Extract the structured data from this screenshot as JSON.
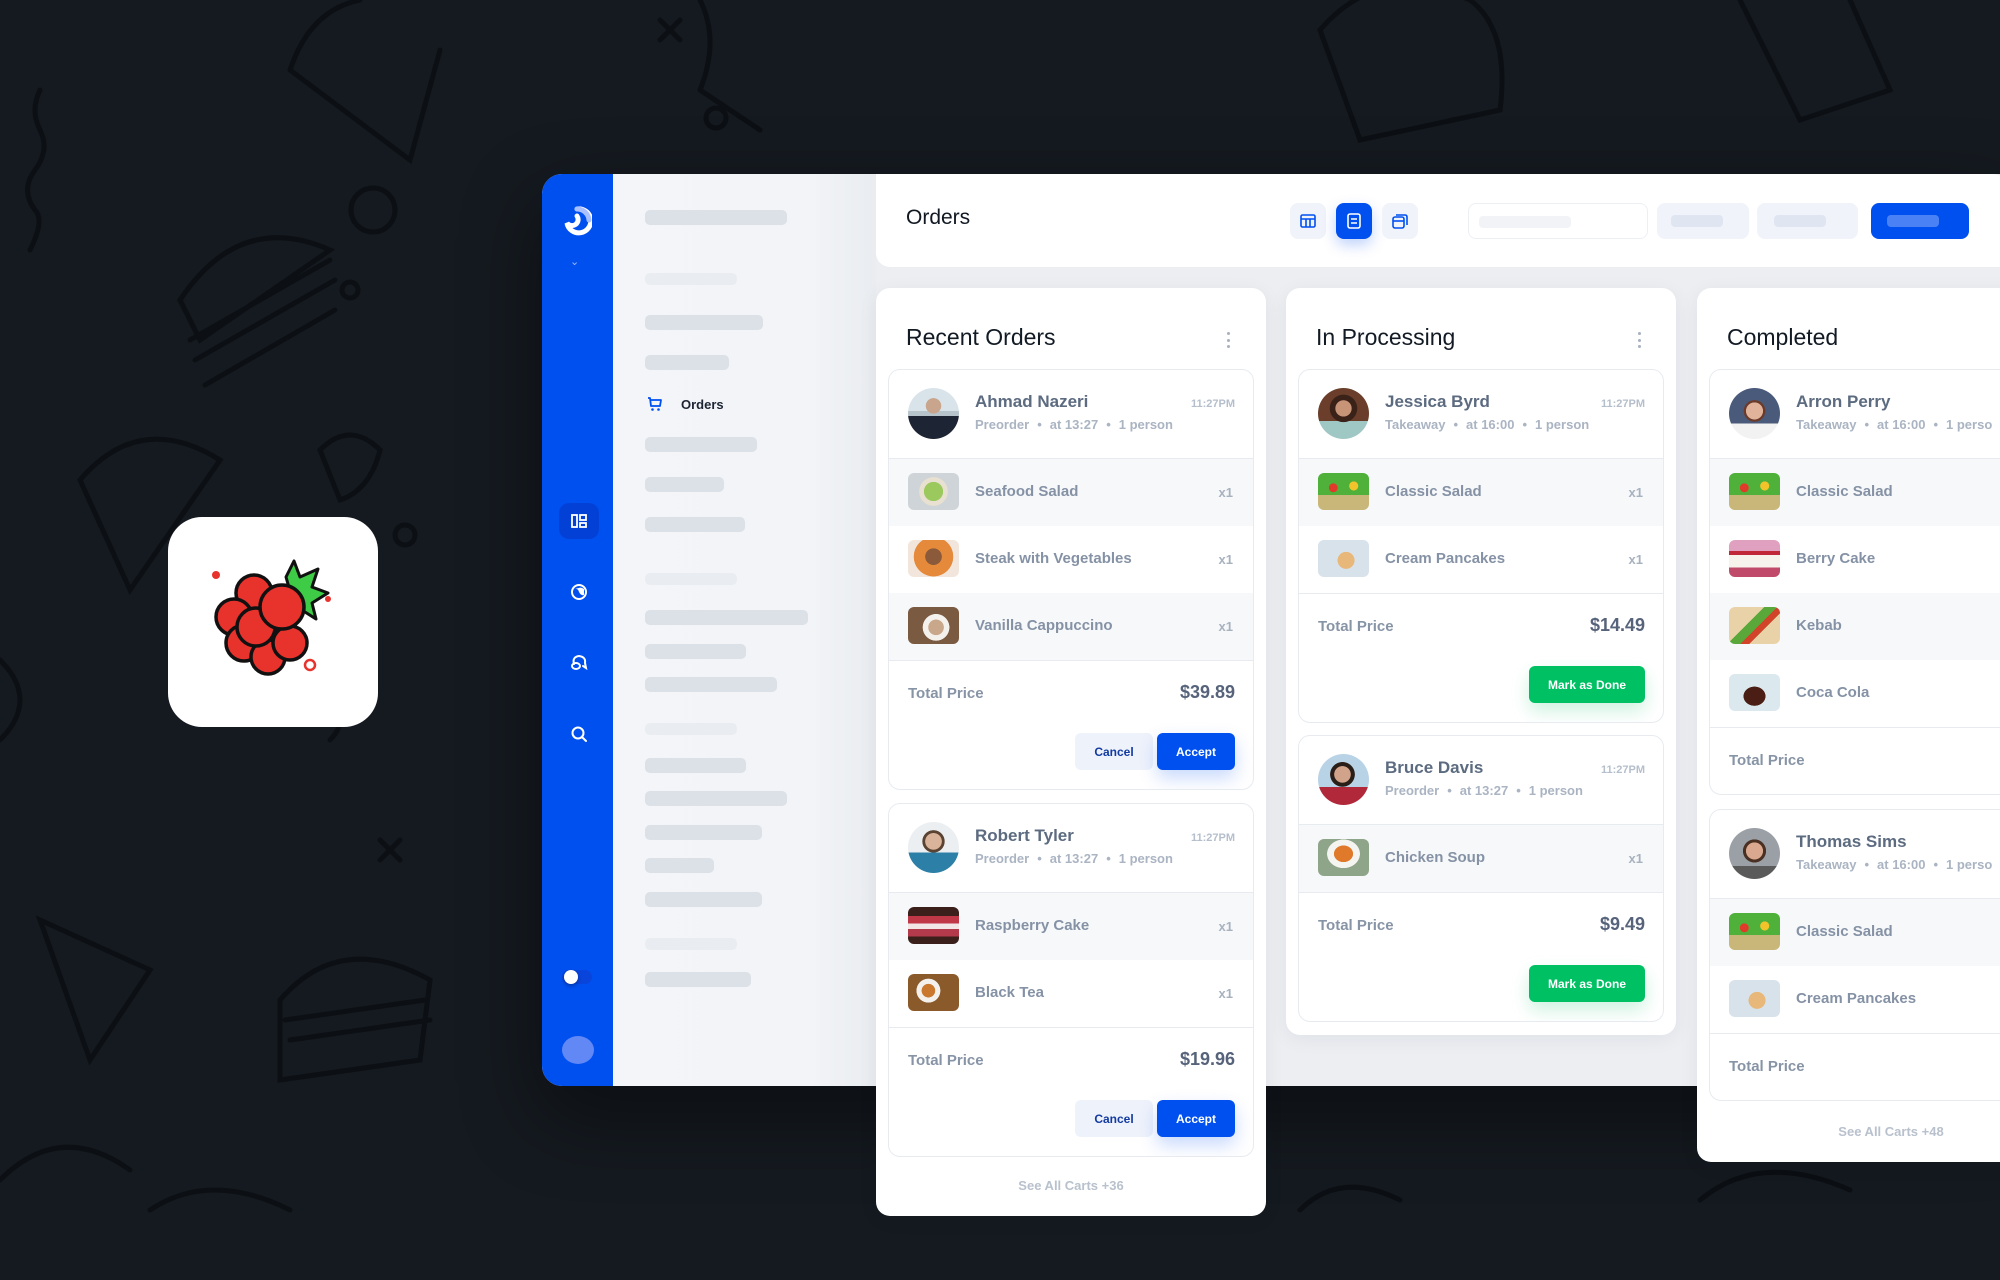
{
  "app": {
    "header_title": "Orders",
    "sidebar_active_item": "Orders",
    "colors": {
      "brand_blue": "#0050f0",
      "success_green": "#00c064",
      "background_dark": "#151a20"
    },
    "rail_icons": [
      "logo-icon",
      "chevron-down-icon",
      "dashboard-icon",
      "globe-icon",
      "chat-icon",
      "search-icon"
    ],
    "view_modes": [
      "table-view",
      "list-view",
      "cards-view"
    ],
    "active_view": "list-view"
  },
  "columns": [
    {
      "title": "Recent Orders",
      "see_all": "See All Carts +36",
      "orders": [
        {
          "name": "Ahmad Nazeri",
          "type": "Preorder",
          "at": "at 13:27",
          "people": "1 person",
          "time": "11:27PM",
          "items": [
            {
              "name": "Seafood Salad",
              "qty": "x1"
            },
            {
              "name": "Steak with Vegetables",
              "qty": "x1"
            },
            {
              "name": "Vanilla Cappuccino",
              "qty": "x1"
            }
          ],
          "total_label": "Total Price",
          "total": "$39.89",
          "actions": [
            "Cancel",
            "Accept"
          ]
        },
        {
          "name": "Robert Tyler",
          "type": "Preorder",
          "at": "at 13:27",
          "people": "1 person",
          "time": "11:27PM",
          "items": [
            {
              "name": "Raspberry Cake",
              "qty": "x1"
            },
            {
              "name": "Black Tea",
              "qty": "x1"
            }
          ],
          "total_label": "Total Price",
          "total": "$19.96",
          "actions": [
            "Cancel",
            "Accept"
          ]
        }
      ]
    },
    {
      "title": "In Processing",
      "orders": [
        {
          "name": "Jessica Byrd",
          "type": "Takeaway",
          "at": "at 16:00",
          "people": "1 person",
          "time": "11:27PM",
          "items": [
            {
              "name": "Classic Salad",
              "qty": "x1"
            },
            {
              "name": "Cream Pancakes",
              "qty": "x1"
            }
          ],
          "total_label": "Total Price",
          "total": "$14.49",
          "actions": [
            "Mark as Done"
          ]
        },
        {
          "name": "Bruce Davis",
          "type": "Preorder",
          "at": "at 13:27",
          "people": "1 person",
          "time": "11:27PM",
          "items": [
            {
              "name": "Chicken Soup",
              "qty": "x1"
            }
          ],
          "total_label": "Total Price",
          "total": "$9.49",
          "actions": [
            "Mark as Done"
          ]
        }
      ]
    },
    {
      "title": "Completed",
      "see_all": "See All Carts +48",
      "orders": [
        {
          "name": "Arron Perry",
          "type": "Takeaway",
          "at": "at 16:00",
          "people": "1 perso",
          "items": [
            {
              "name": "Classic Salad"
            },
            {
              "name": "Berry Cake"
            },
            {
              "name": "Kebab"
            },
            {
              "name": "Coca Cola"
            }
          ],
          "total_label": "Total Price"
        },
        {
          "name": "Thomas Sims",
          "type": "Takeaway",
          "at": "at 16:00",
          "people": "1 perso",
          "items": [
            {
              "name": "Classic Salad"
            },
            {
              "name": "Cream Pancakes"
            }
          ],
          "total_label": "Total Price"
        }
      ]
    }
  ]
}
